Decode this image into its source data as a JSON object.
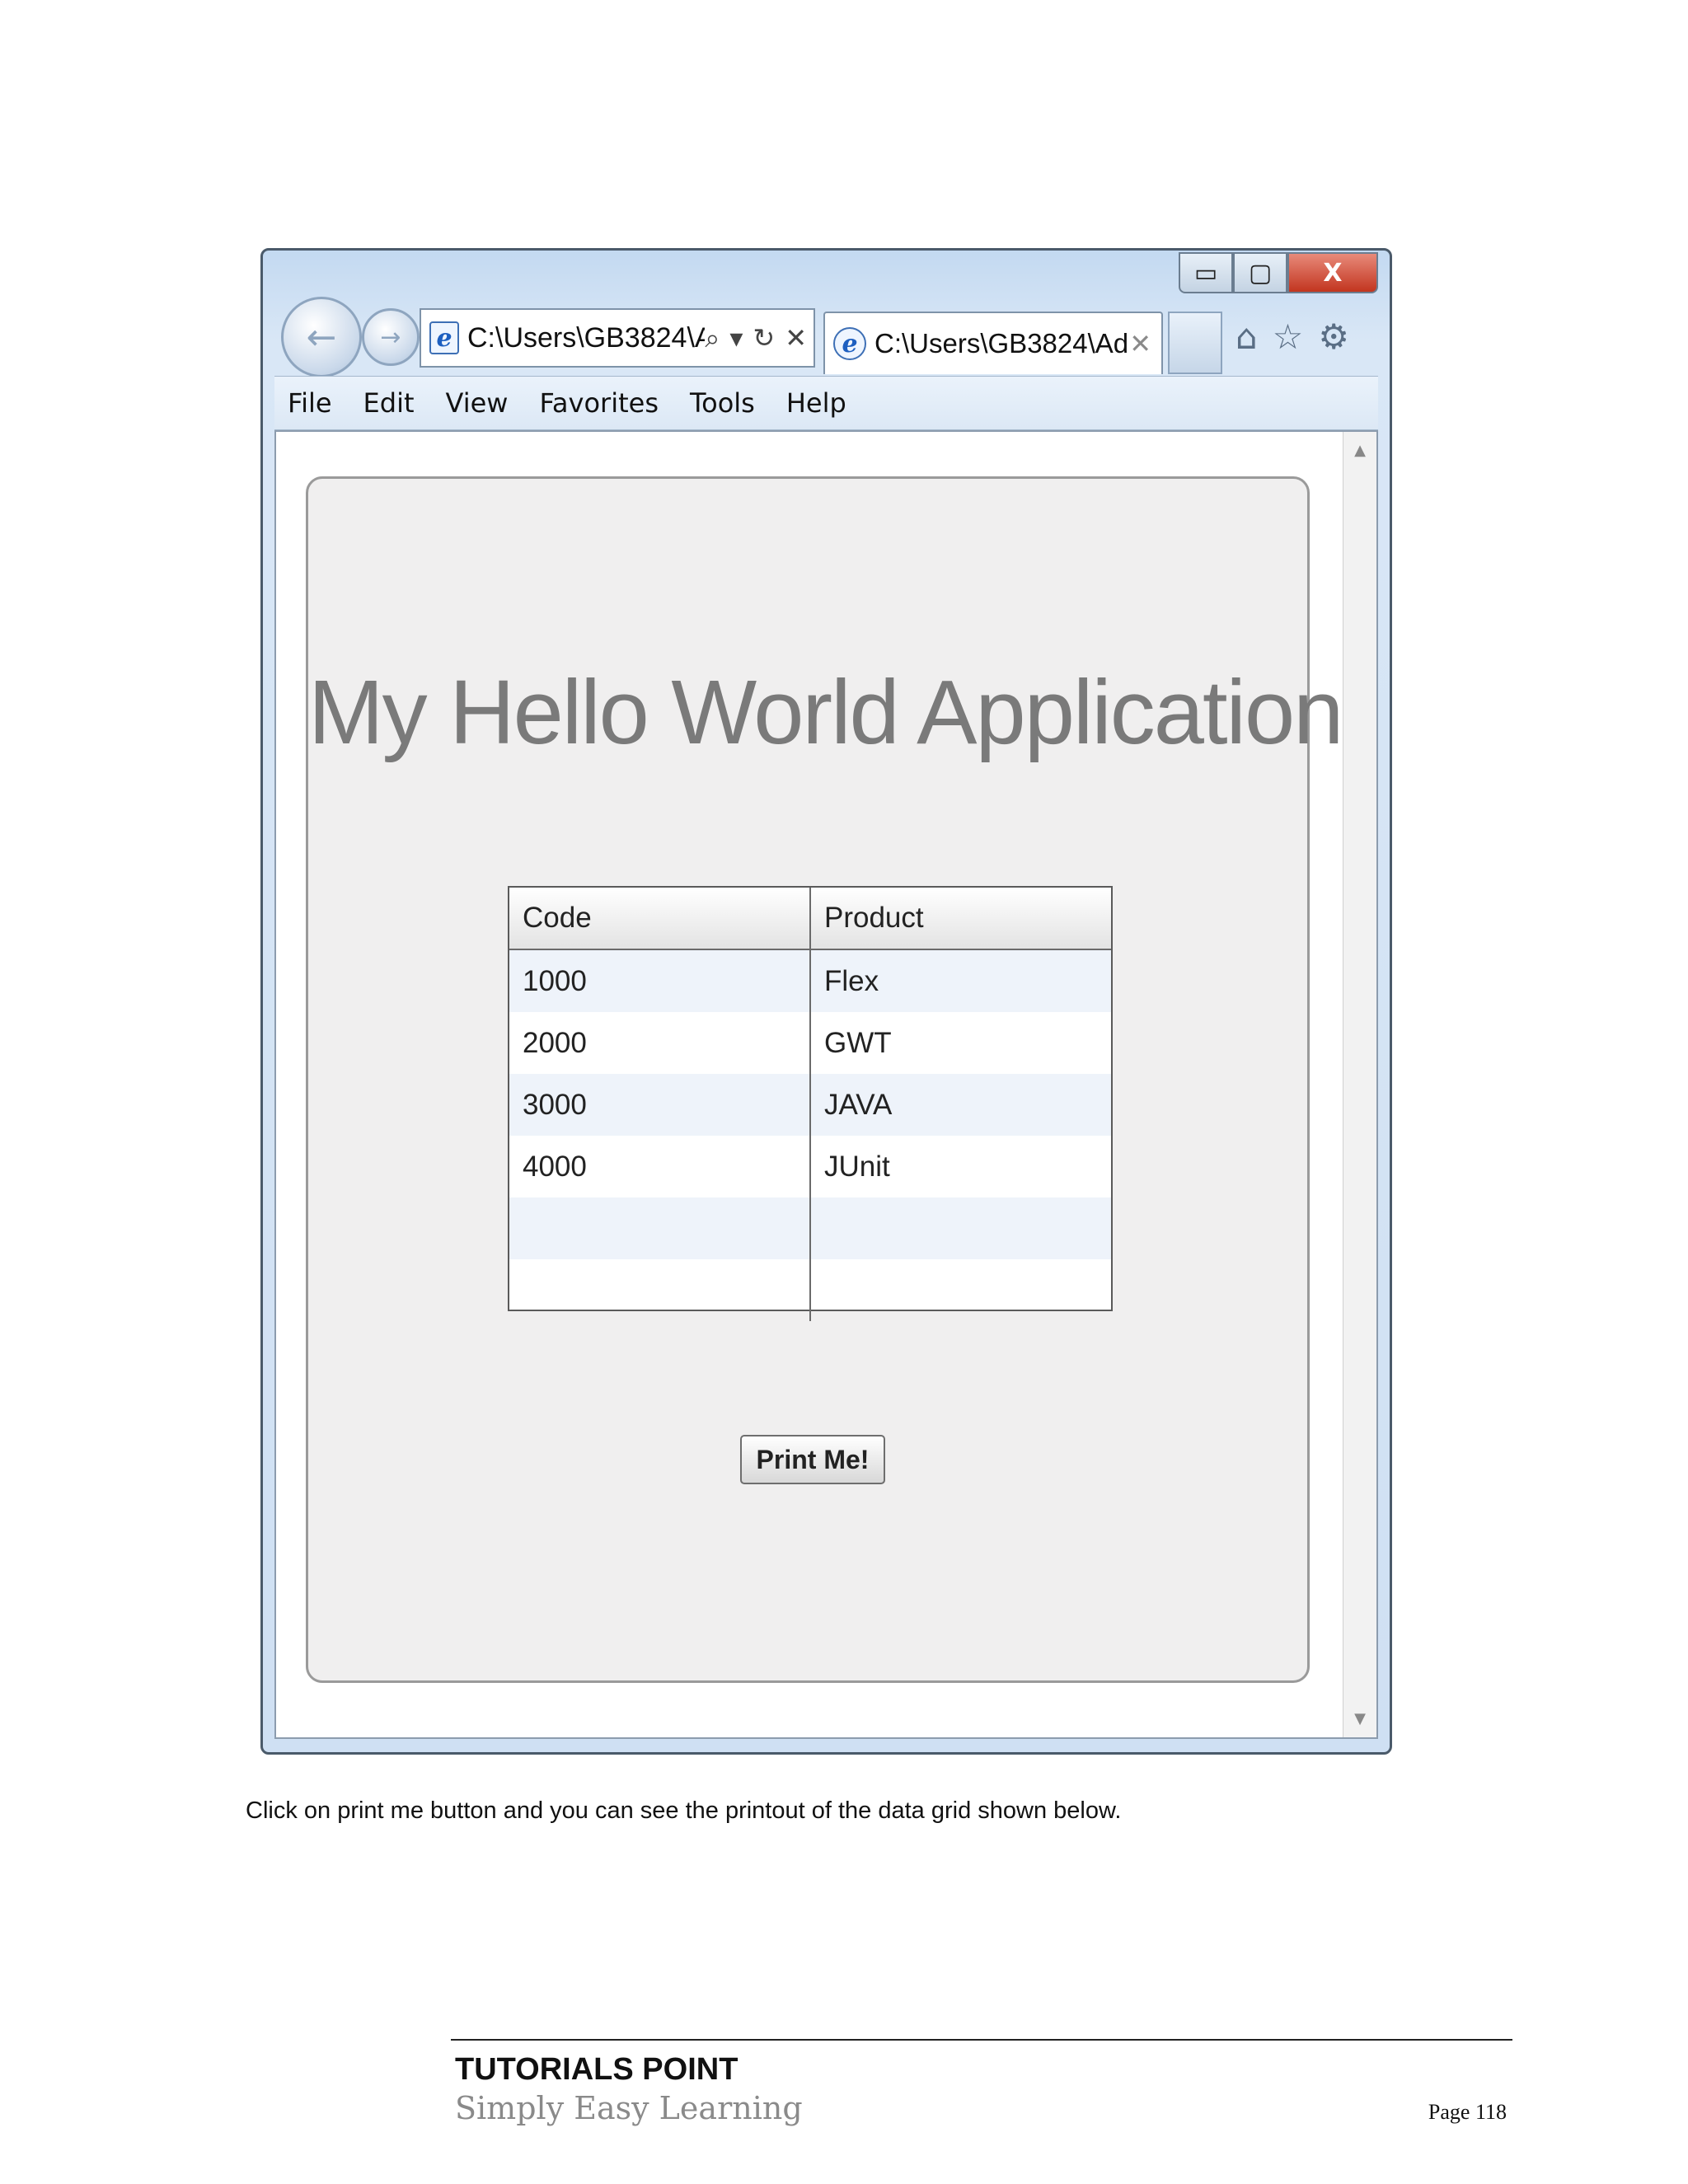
{
  "browser": {
    "address_text": "C:\\Users\\GB3824\\A",
    "address_tools": [
      "⌕",
      "▾",
      "↻",
      "✕"
    ],
    "tab_title": "C:\\Users\\GB3824\\Ado...",
    "tab_close": "✕",
    "window_controls": {
      "minimize": "▭",
      "maximize": "▢",
      "close": "X"
    },
    "nav": {
      "back": "←",
      "forward": "→"
    },
    "toolbar_icons": [
      "home-icon",
      "star-icon",
      "gear-icon"
    ],
    "menu": [
      "File",
      "Edit",
      "View",
      "Favorites",
      "Tools",
      "Help"
    ],
    "scroll": {
      "up": "▲",
      "down": "▼"
    }
  },
  "app": {
    "title": "My Hello World Application",
    "grid": {
      "columns": [
        "Code",
        "Product"
      ],
      "rows": [
        [
          "1000",
          "Flex"
        ],
        [
          "2000",
          "GWT"
        ],
        [
          "3000",
          "JAVA"
        ],
        [
          "4000",
          "JUnit"
        ],
        [
          "",
          ""
        ],
        [
          "",
          ""
        ]
      ]
    },
    "print_button": "Print Me!"
  },
  "document": {
    "caption": "Click on print me button and you can see the printout of the data grid shown below.",
    "footer": {
      "brand": "TUTORIALS POINT",
      "tagline": "Simply Easy Learning",
      "page": "Page 118"
    }
  }
}
